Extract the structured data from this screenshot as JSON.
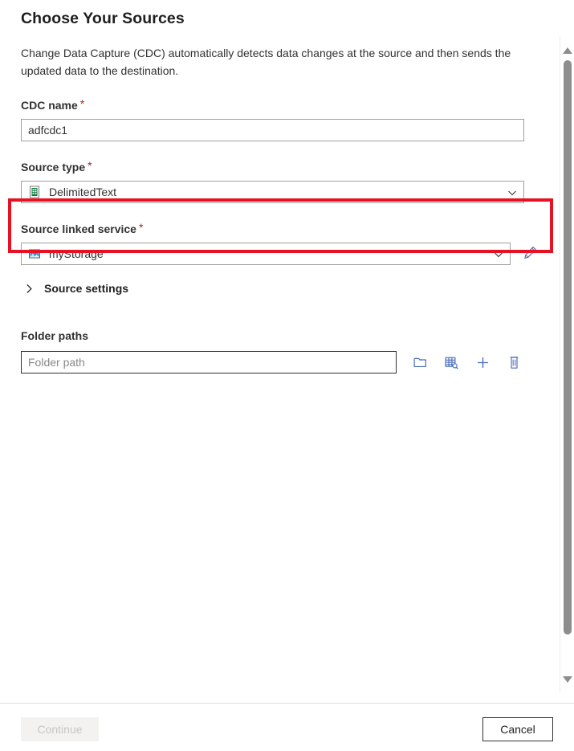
{
  "page": {
    "title": "Choose Your Sources",
    "description": "Change Data Capture (CDC) automatically detects data changes at the source and then sends the updated data to the destination."
  },
  "fields": {
    "cdc_name": {
      "label": "CDC name",
      "required_marker": "*",
      "value": "adfcdc1",
      "placeholder": ""
    },
    "source_type": {
      "label": "Source type",
      "required_marker": "*",
      "value": "DelimitedText",
      "icon": "delimited-text-icon",
      "chevron": "chevron-down-icon"
    },
    "source_linked_service": {
      "label": "Source linked service",
      "required_marker": "*",
      "value": "myStorage",
      "icon": "azure-blob-storage-icon",
      "chevron": "chevron-down-icon",
      "edit_icon": "pencil-icon",
      "highlighted": true,
      "highlight_color": "#e81123"
    },
    "source_settings": {
      "label": "Source settings",
      "expanded": false,
      "chevron": "chevron-right-icon"
    },
    "folder_paths": {
      "label": "Folder paths",
      "input_placeholder": "Folder path",
      "input_value": "",
      "actions": [
        {
          "name": "browse-folder-icon",
          "title": "Browse"
        },
        {
          "name": "preview-data-icon",
          "title": "Preview data"
        },
        {
          "name": "add-icon",
          "title": "Add"
        },
        {
          "name": "delete-icon",
          "title": "Delete"
        }
      ]
    }
  },
  "scrollbar": {
    "up_arrow": "scroll-up-arrow",
    "down_arrow": "scroll-down-arrow",
    "thumb": "scrollbar-thumb"
  },
  "footer": {
    "continue_label": "Continue",
    "continue_disabled": true,
    "cancel_label": "Cancel"
  },
  "colors": {
    "accent_red": "#e81123",
    "required_star": "#a4262c",
    "icon_blue": "#4a6cb8",
    "field_border": "#a19f9d"
  }
}
